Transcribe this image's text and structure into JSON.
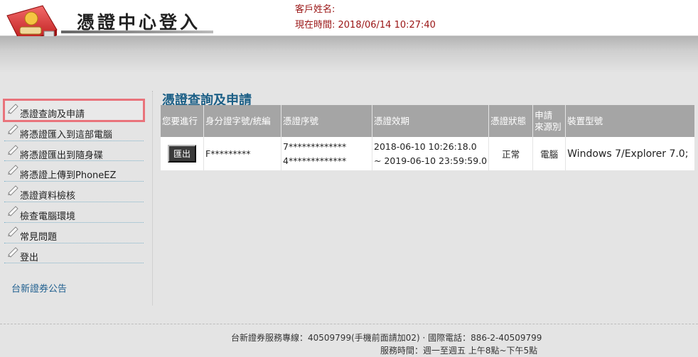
{
  "header": {
    "title": "憑證中心登入",
    "customer_label": "客戶姓名:",
    "time_label": "現在時間: 2018/06/14 10:27:40"
  },
  "colors": {
    "accent": "#1c5f86",
    "header_text": "#9a1515",
    "active_outline": "#e9737b",
    "table_header": "#a5a5a5"
  },
  "sidebar": {
    "items": [
      {
        "label": "憑證查詢及申請",
        "icon": "pencil-icon",
        "active": true
      },
      {
        "label": "將憑證匯入到這部電腦",
        "icon": "pencil-icon"
      },
      {
        "label": "將憑證匯出到隨身碟",
        "icon": "pencil-icon"
      },
      {
        "label": "將憑證上傳到PhoneEZ",
        "icon": "pencil-icon"
      },
      {
        "label": "憑證資料檢核",
        "icon": "pencil-icon"
      },
      {
        "label": "檢查電腦環境",
        "icon": "pencil-icon"
      },
      {
        "label": "常見問題",
        "icon": "pencil-icon"
      },
      {
        "label": "登出",
        "icon": "pencil-icon"
      }
    ],
    "announcement": "台新證券公告"
  },
  "main": {
    "title": "憑證查詢及申請",
    "columns": [
      "您要進行",
      "身分證字號/統編",
      "憑證序號",
      "憑證效期",
      "憑證狀態",
      "申請來源別",
      "裝置型號"
    ],
    "column_lines": {
      "source_line1": "申請",
      "source_line2": "來源別"
    },
    "row": {
      "action": "匯出",
      "id": "F*********",
      "serial_1": "7*************",
      "serial_2": "4*************",
      "validity_1": "2018-06-10 10:26:18.0",
      "validity_2": "~ 2019-06-10 23:59:59.0",
      "status": "正常",
      "source": "電腦",
      "device": "Windows 7/Explorer 7.0;"
    }
  },
  "footer": {
    "line1": "台新證券服務專線：40509799(手機前面請加02) · 國際電話：886-2-40509799",
    "line2": "服務時間：週一至週五 上午8點~下午5點"
  }
}
